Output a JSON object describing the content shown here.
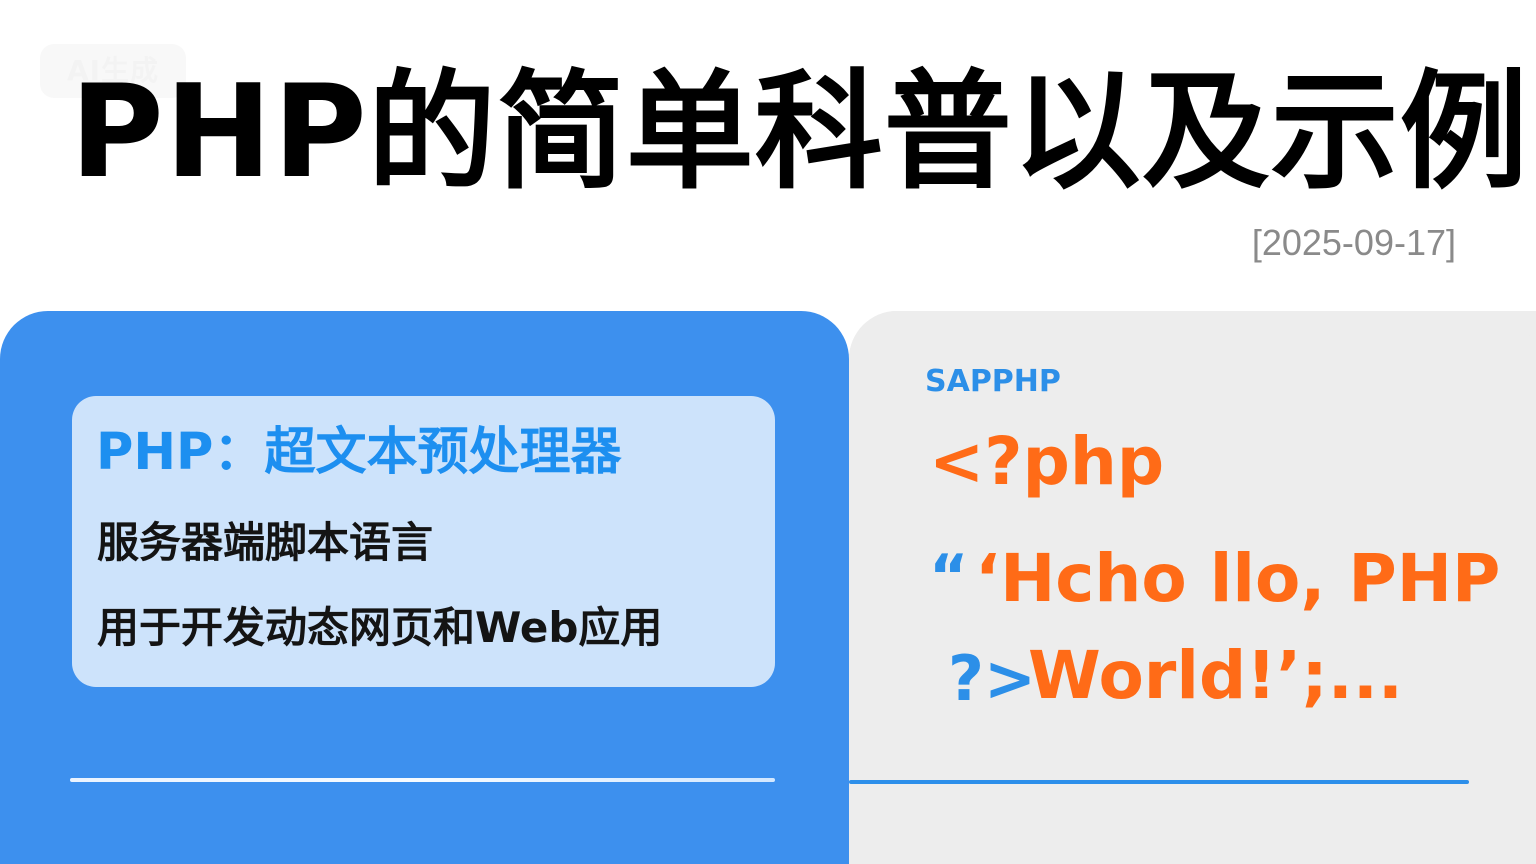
{
  "watermark": {
    "text": "AI生成"
  },
  "title": {
    "text": "PHP的简单科普以及示例"
  },
  "date": {
    "text": "[2025-09-17]"
  },
  "left_panel": {
    "card_title": "PHP：超文本预处理器",
    "line_1": "服务器端脚本语言",
    "line_2": "用于开发动态网页和Web应用"
  },
  "right_panel": {
    "label": "SAPPHP",
    "code_open": "<?php",
    "code_quote": "“",
    "code_hello": "‘Hcho llo, PHP",
    "code_close": "?>",
    "code_world": "World!’;..."
  },
  "colors": {
    "blue": "#3d90ee",
    "light_blue": "#cde3fb",
    "accent_blue": "#2c8fe8",
    "orange": "#ff6b17",
    "gray": "#ededed"
  }
}
